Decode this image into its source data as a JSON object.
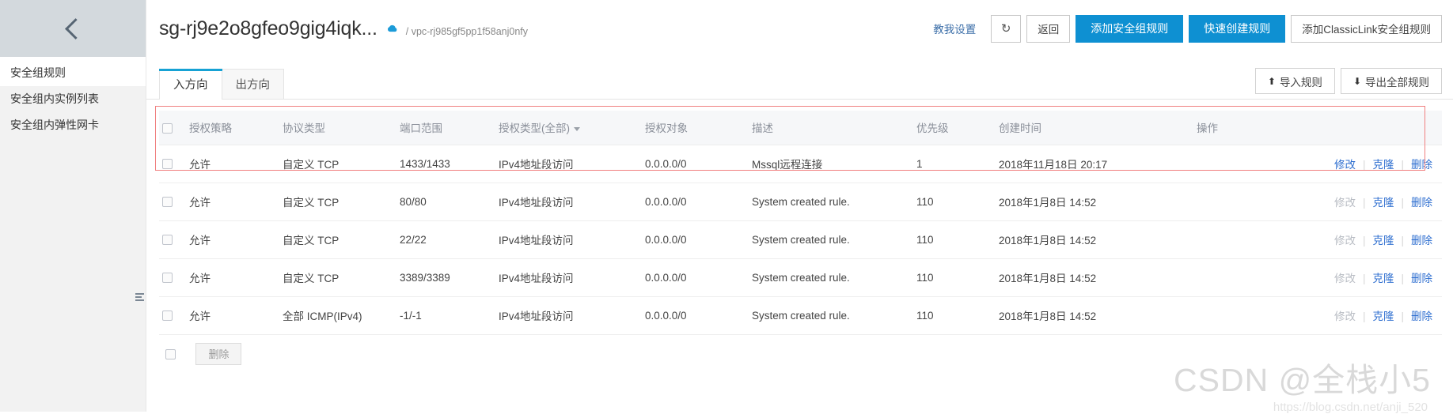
{
  "sidebar": {
    "collapse_icon": "chevron-left-icon",
    "items": [
      {
        "label": "安全组规则"
      },
      {
        "label": "安全组内实例列表"
      },
      {
        "label": "安全组内弹性网卡"
      }
    ],
    "handle_icon": "drag-handle-icon"
  },
  "header": {
    "title": "sg-rj9e2o8gfeo9gig4iqk...",
    "cloud_icon": "cloud-icon",
    "vpc_path": "/ vpc-rj985gf5pp1f58anj0nfy",
    "teach_link": "教我设置",
    "refresh_icon": "refresh-icon",
    "back_button": "返回",
    "add_rule_button": "添加安全组规则",
    "quick_create_button": "快速创建规则",
    "classiclink_button": "添加ClassicLink安全组规则",
    "accent_color": "#0e90d2"
  },
  "tabs": [
    {
      "label": "入方向",
      "active": true
    },
    {
      "label": "出方向",
      "active": false
    }
  ],
  "toolbar": {
    "import_label": "导入规则",
    "export_label": "导出全部规则",
    "import_icon": "upload-icon",
    "export_icon": "download-icon"
  },
  "table": {
    "columns": [
      {
        "key": "checkbox",
        "label": ""
      },
      {
        "key": "policy",
        "label": "授权策略"
      },
      {
        "key": "protocol",
        "label": "协议类型"
      },
      {
        "key": "port",
        "label": "端口范围"
      },
      {
        "key": "auth_type",
        "label": "授权类型(全部)",
        "has_filter": true
      },
      {
        "key": "object",
        "label": "授权对象"
      },
      {
        "key": "description",
        "label": "描述"
      },
      {
        "key": "priority",
        "label": "优先级"
      },
      {
        "key": "create_time",
        "label": "创建时间"
      },
      {
        "key": "operations",
        "label": "操作"
      }
    ],
    "ops": {
      "modify": "修改",
      "clone": "克隆",
      "delete": "删除"
    },
    "rows": [
      {
        "policy": "允许",
        "protocol": "自定义 TCP",
        "port": "1433/1433",
        "auth_type": "IPv4地址段访问",
        "object": "0.0.0.0/0",
        "description": "Mssql远程连接",
        "priority": "1",
        "create_time": "2018年11月18日 20:17",
        "modify_enabled": true,
        "highlighted": true
      },
      {
        "policy": "允许",
        "protocol": "自定义 TCP",
        "port": "80/80",
        "auth_type": "IPv4地址段访问",
        "object": "0.0.0.0/0",
        "description": "System created rule.",
        "priority": "110",
        "create_time": "2018年1月8日 14:52",
        "modify_enabled": false,
        "highlighted": false
      },
      {
        "policy": "允许",
        "protocol": "自定义 TCP",
        "port": "22/22",
        "auth_type": "IPv4地址段访问",
        "object": "0.0.0.0/0",
        "description": "System created rule.",
        "priority": "110",
        "create_time": "2018年1月8日 14:52",
        "modify_enabled": false,
        "highlighted": false
      },
      {
        "policy": "允许",
        "protocol": "自定义 TCP",
        "port": "3389/3389",
        "auth_type": "IPv4地址段访问",
        "object": "0.0.0.0/0",
        "description": "System created rule.",
        "priority": "110",
        "create_time": "2018年1月8日 14:52",
        "modify_enabled": false,
        "highlighted": false
      },
      {
        "policy": "允许",
        "protocol": "全部 ICMP(IPv4)",
        "port": "-1/-1",
        "auth_type": "IPv4地址段访问",
        "object": "0.0.0.0/0",
        "description": "System created rule.",
        "priority": "110",
        "create_time": "2018年1月8日 14:52",
        "modify_enabled": false,
        "highlighted": false
      }
    ]
  },
  "bottom": {
    "delete_button": "删除"
  },
  "watermark": {
    "text": "CSDN @全栈小5",
    "sub": "https://blog.csdn.net/anji_520"
  }
}
